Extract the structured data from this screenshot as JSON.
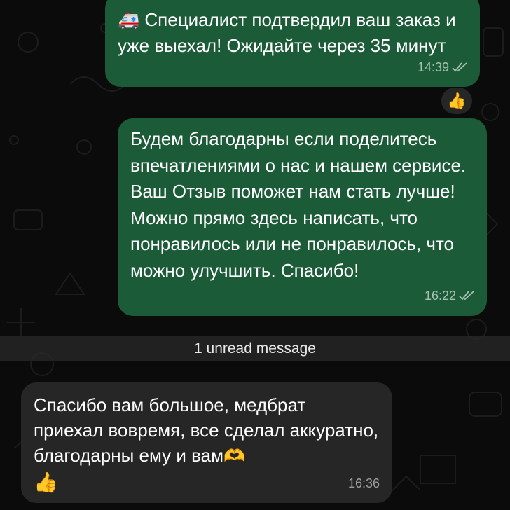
{
  "messages": [
    {
      "icon": "ambulance-emoji",
      "text": "Специалист подтвердил ваш заказ и уже выехал! Ожидайте через 35 минут",
      "time": "14:39",
      "direction": "outgoing",
      "status": "read"
    },
    {
      "text": "Будем благодарны если поделитесь впечатлениями о нас и нашем сервисе. Ваш Отзыв поможет нам стать лучше! Можно прямо здесь написать, что понравилось или не понравилось, что можно улучшить. Спасибо!",
      "time": "16:22",
      "direction": "outgoing",
      "status": "read"
    },
    {
      "text": "Спасибо вам большое, медбрат приехал вовремя, все сделал аккуратно, благодарны ему и вам",
      "emoji_inline": "heart-hands-emoji",
      "emoji_line": "thumbs-up-emoji",
      "time": "16:36",
      "direction": "incoming"
    }
  ],
  "reaction": {
    "emoji": "thumbs-up-emoji"
  },
  "unread_divider": "1 unread message",
  "colors": {
    "outgoing_bubble": "#1c5b38",
    "incoming_bubble": "#262626",
    "background": "#0b0b0b"
  }
}
